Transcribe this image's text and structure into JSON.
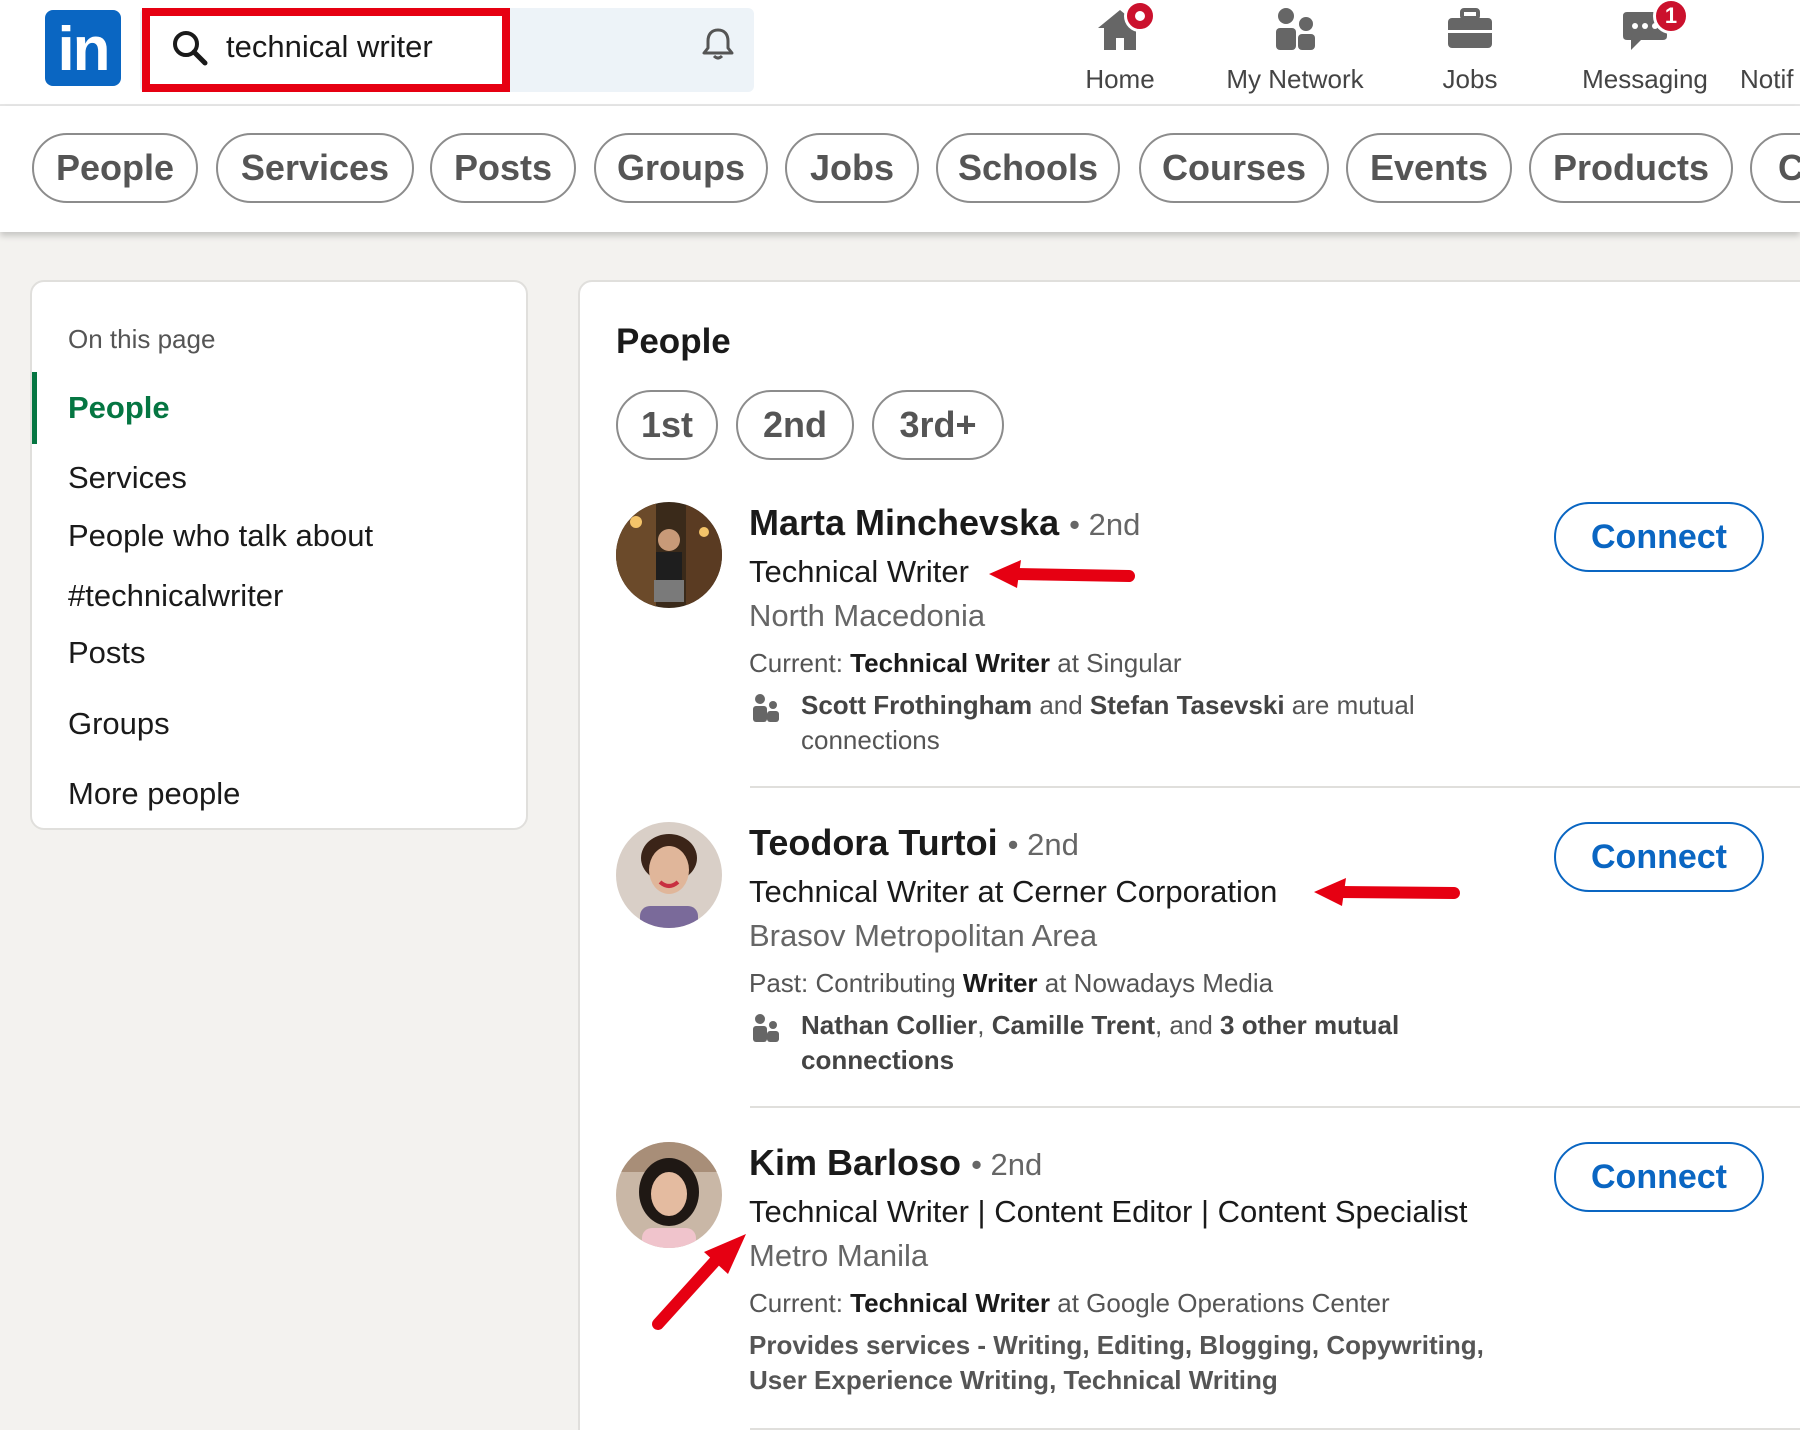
{
  "brand": {
    "logo_text": "in"
  },
  "search": {
    "value": "technical writer"
  },
  "nav": {
    "items": [
      {
        "key": "home",
        "label": "Home",
        "badge": ""
      },
      {
        "key": "network",
        "label": "My Network",
        "badge": ""
      },
      {
        "key": "jobs",
        "label": "Jobs",
        "badge": ""
      },
      {
        "key": "messaging",
        "label": "Messaging",
        "badge": "1"
      },
      {
        "key": "notifications",
        "label": "Notif",
        "badge": ""
      }
    ]
  },
  "filters": [
    "People",
    "Services",
    "Posts",
    "Groups",
    "Jobs",
    "Schools",
    "Courses",
    "Events",
    "Products",
    "C"
  ],
  "sidebar": {
    "heading": "On this page",
    "items": [
      {
        "label": "People"
      },
      {
        "label": "Services"
      },
      {
        "label": "People who talk about"
      },
      {
        "label": "#technicalwriter"
      },
      {
        "label": "Posts"
      },
      {
        "label": "Groups"
      },
      {
        "label": "More people"
      }
    ]
  },
  "main": {
    "title": "People",
    "degree_filters": [
      "1st",
      "2nd",
      "3rd+"
    ],
    "results": [
      {
        "name": "Marta Minchevska",
        "degree": "• 2nd",
        "headline": "Technical Writer",
        "location": "North Macedonia",
        "context_prefix": "Current: ",
        "context_bold": "Technical Writer",
        "context_suffix": " at Singular",
        "mutual_a": "Scott Frothingham",
        "mutual_and": " and ",
        "mutual_b": "Stefan Tasevski",
        "mutual_tail": " are mutual connections",
        "connect_label": "Connect"
      },
      {
        "name": "Teodora Turtoi",
        "degree": "• 2nd",
        "headline": "Technical Writer at Cerner Corporation",
        "location": "Brasov Metropolitan Area",
        "context_prefix": "Past: Contributing ",
        "context_bold": "Writer",
        "context_suffix": " at Nowadays Media",
        "mutual_a": "Nathan Collier",
        "mutual_sep1": ", ",
        "mutual_b": "Camille Trent",
        "mutual_sep2": ", and ",
        "mutual_c": "3 other mutual connections",
        "connect_label": "Connect"
      },
      {
        "name": "Kim Barloso",
        "degree": "• 2nd",
        "headline": "Technical Writer | Content Editor | Content Specialist",
        "location": "Metro Manila",
        "context_prefix": "Current: ",
        "context_bold": "Technical Writer",
        "context_suffix": " at Google Operations Center",
        "services": "Provides services - Writing, Editing, Blogging, Copywriting, User Experience Writing, Technical Writing",
        "connect_label": "Connect"
      }
    ]
  },
  "colors": {
    "brand": "#0a66c2",
    "active_green": "#057642",
    "annotation_red": "#e60012",
    "badge_red": "#cb112d"
  }
}
